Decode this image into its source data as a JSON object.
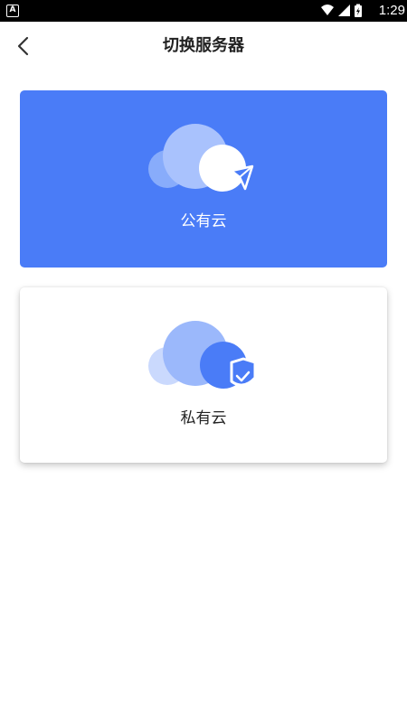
{
  "status_bar": {
    "app_badge": "A",
    "time": "1:29",
    "icons": [
      "wifi-icon",
      "cellular-signal-icon",
      "battery-charging-icon"
    ]
  },
  "header": {
    "title": "切换服务器",
    "back_icon": "chevron-left-icon"
  },
  "options": [
    {
      "label": "公有云",
      "icon": "cloud-send-icon",
      "selected": true
    },
    {
      "label": "私有云",
      "icon": "cloud-shield-icon",
      "selected": false
    }
  ],
  "colors": {
    "accent": "#4a7cf7",
    "selected_text": "#ffffff",
    "unselected_text": "#222222",
    "status_bar": "#000000"
  }
}
